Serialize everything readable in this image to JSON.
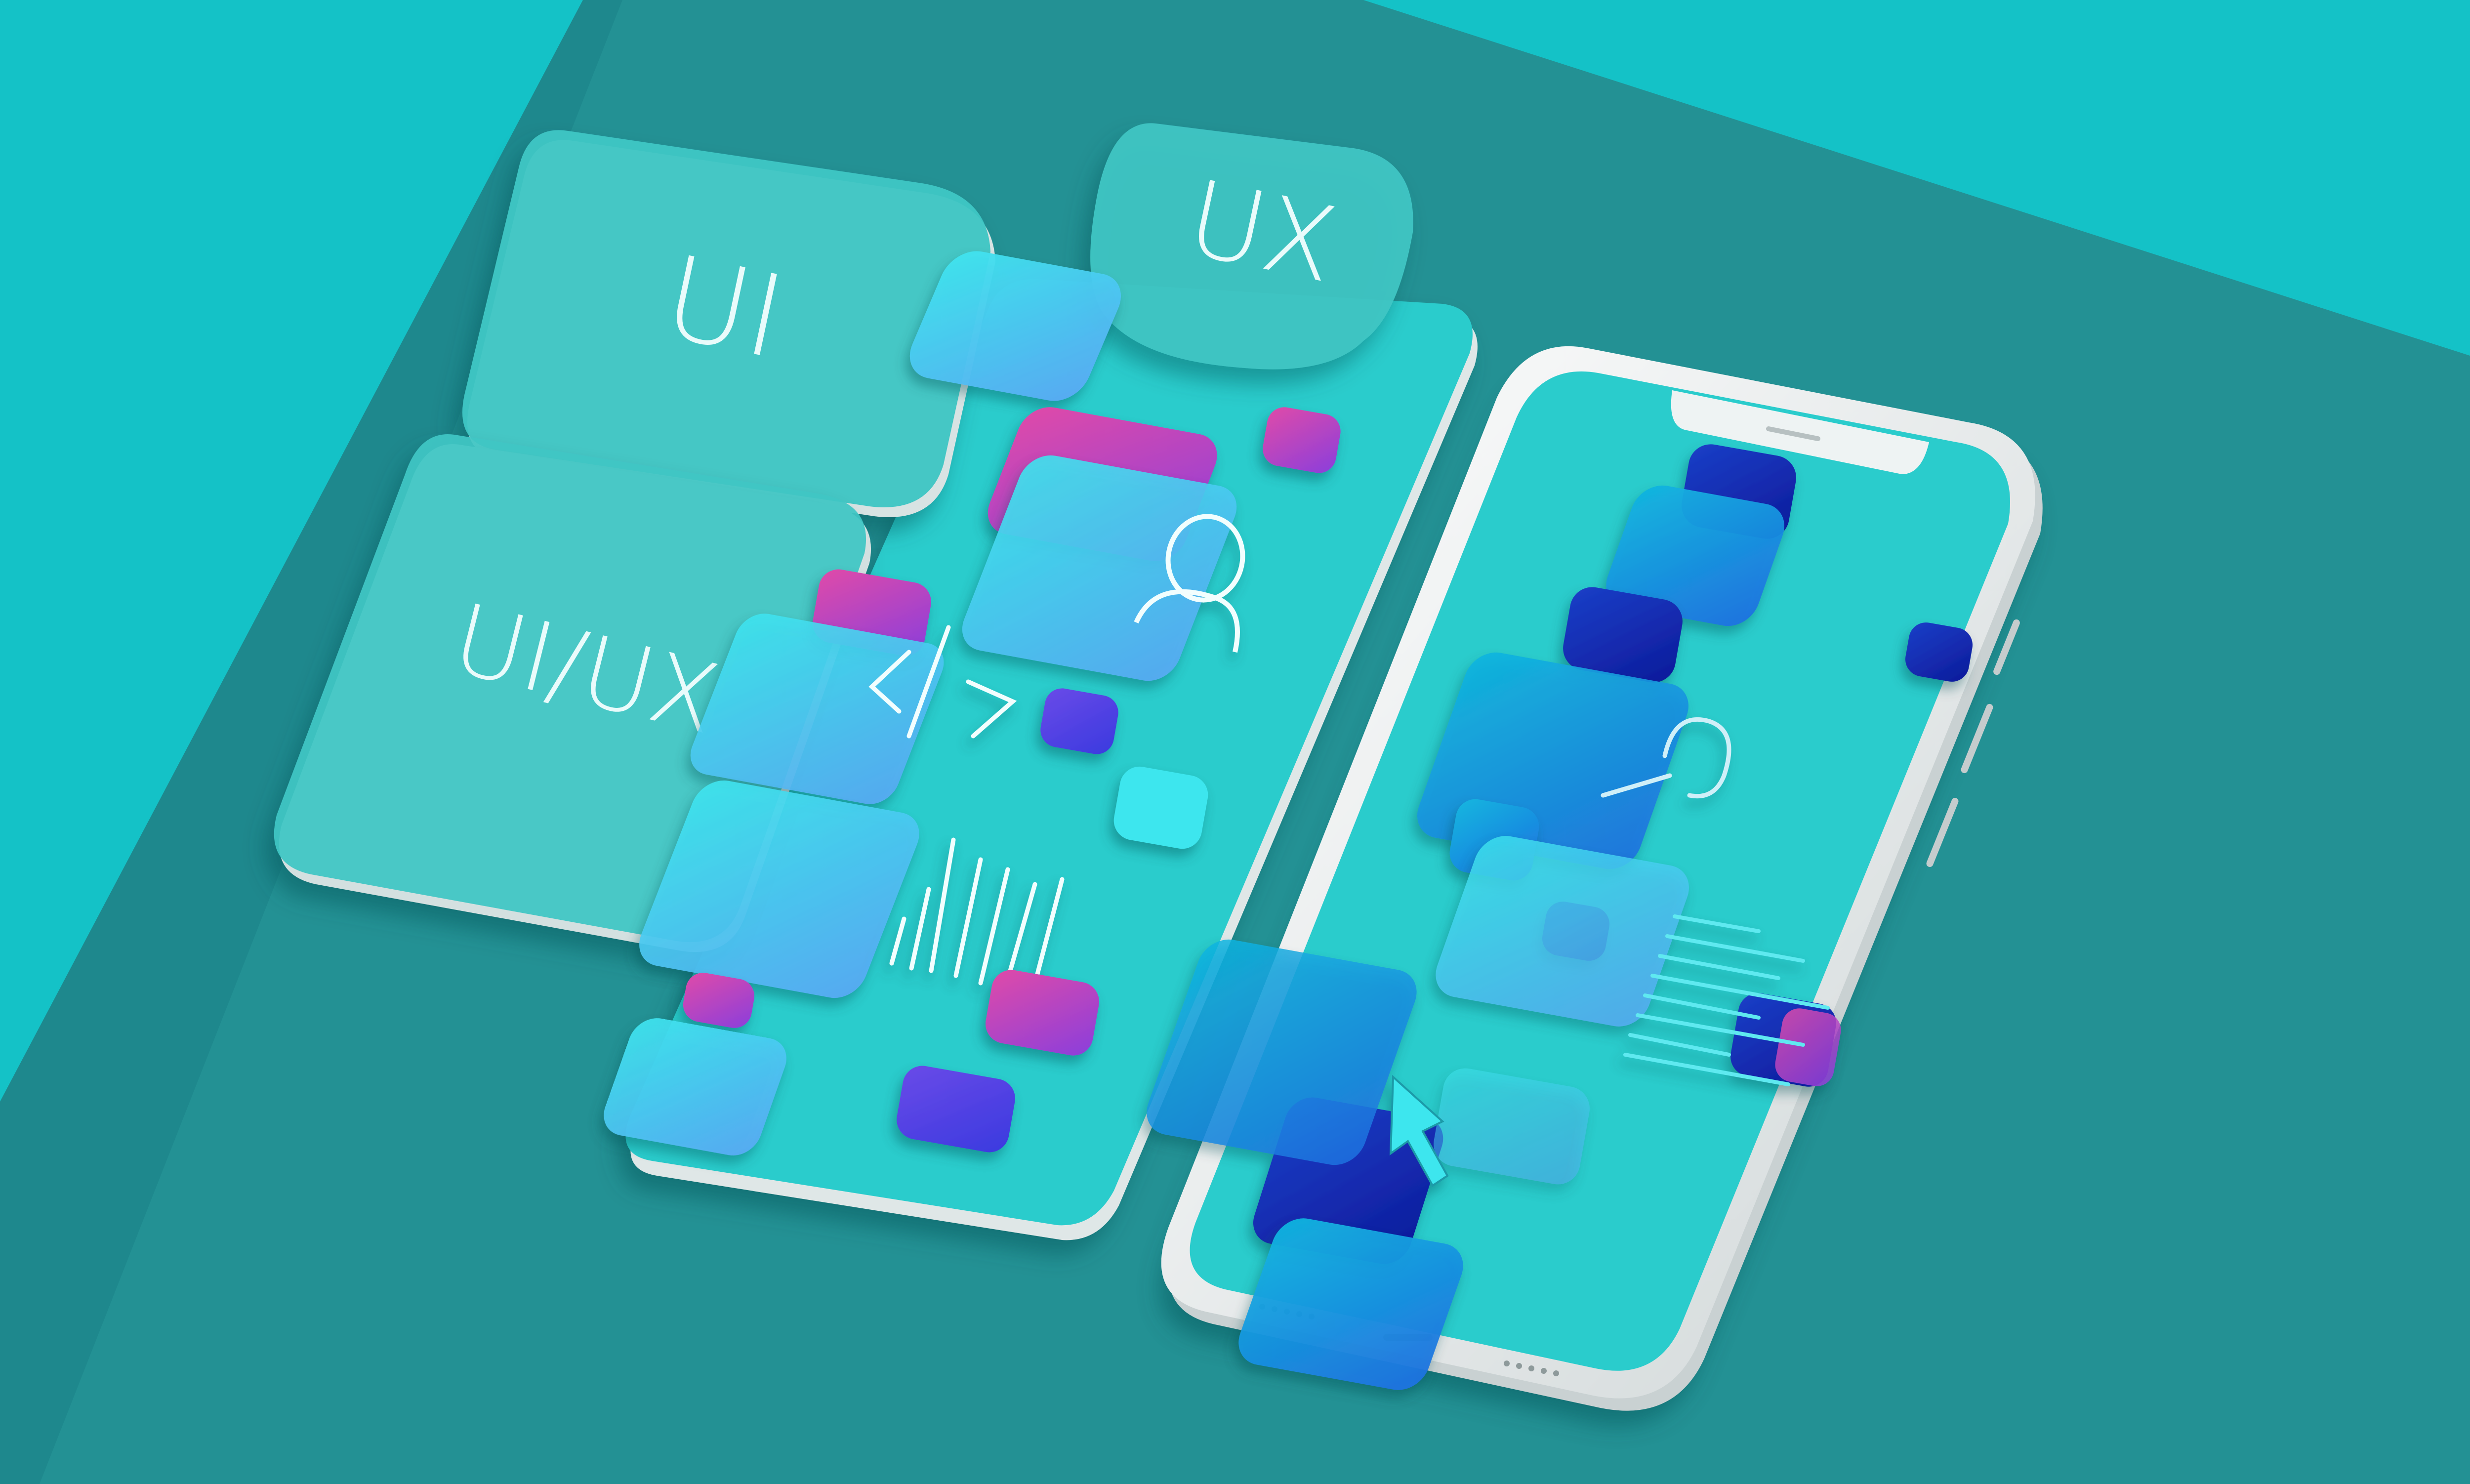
{
  "colors": {
    "background_cyan": "#14c2c7",
    "platform_teal": "#239194",
    "platform_dark": "#1f8a8d",
    "screen_teal": "#2acccc",
    "glass_teal": "#3ec6c4",
    "phone_frame": "#e9eeee",
    "accent_blue": "#1f6fe0",
    "accent_navy": "#1020a8",
    "accent_magenta": "#c03fc6",
    "accent_purple": "#7a3fe0",
    "line_white": "#f2fefe"
  },
  "labels": {
    "ui_card": "UI",
    "ux_card": "UX",
    "uiux_card": "UI/UX"
  },
  "icons": {
    "user_tile": "user-icon",
    "code_tile": "code-brackets-icon",
    "chart_tile": "bar-chart-icon",
    "search_tile": "search-icon",
    "text_tile": "text-lines-icon",
    "pointer_tile": "cursor-arrow-icon"
  }
}
